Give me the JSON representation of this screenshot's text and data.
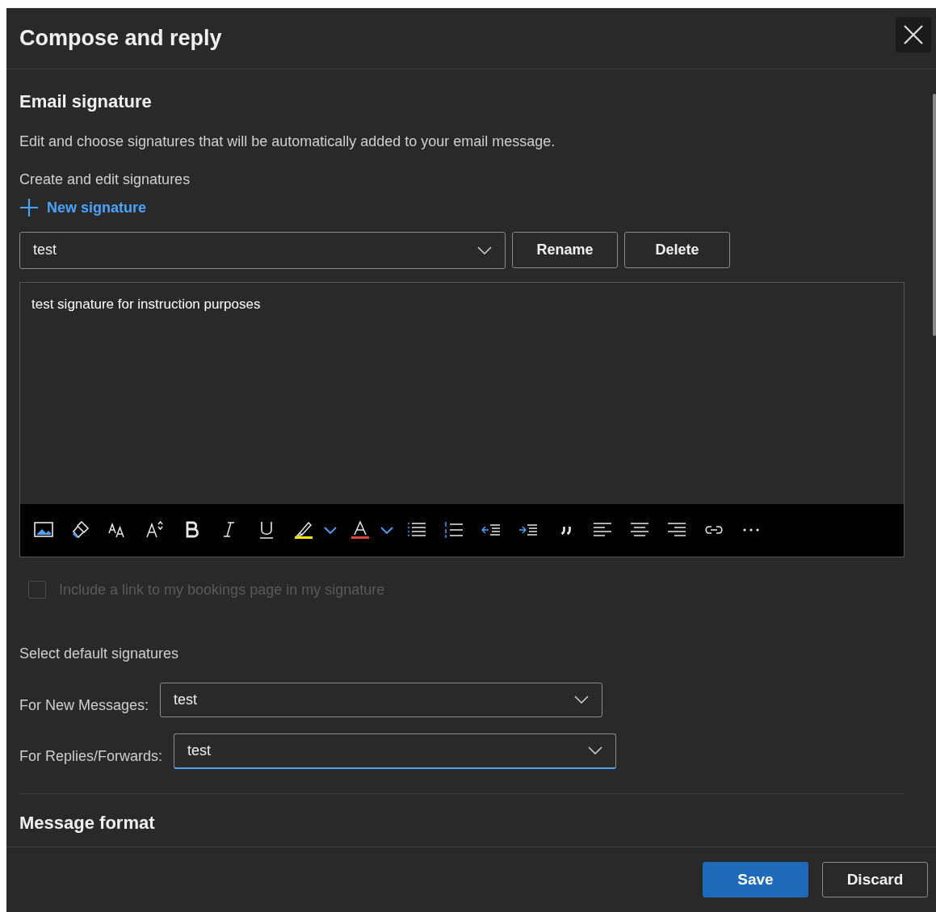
{
  "dialog": {
    "title": "Compose and reply"
  },
  "signature_section": {
    "heading": "Email signature",
    "description": "Edit and choose signatures that will be automatically added to your email message.",
    "subheading": "Create and edit signatures",
    "new_signature": "New signature",
    "signature_select": {
      "value": "test"
    },
    "buttons": [
      "Rename",
      "Delete"
    ],
    "editor": {
      "text": "test signature for instruction purposes"
    },
    "bookings_checkbox": {
      "label": "Include a link to my bookings page in my signature",
      "checked": false,
      "disabled": true
    },
    "defaults": {
      "heading": "Select default signatures",
      "fields": [
        {
          "label": "For New Messages:",
          "value": "test",
          "focused": false
        },
        {
          "label": "For Replies/Forwards:",
          "value": "test",
          "focused": true
        }
      ]
    }
  },
  "next_section": {
    "heading": "Message format"
  },
  "footer": {
    "buttons": [
      {
        "label": "Save",
        "kind": "primary"
      },
      {
        "label": "Discard",
        "kind": "secondary"
      }
    ]
  }
}
